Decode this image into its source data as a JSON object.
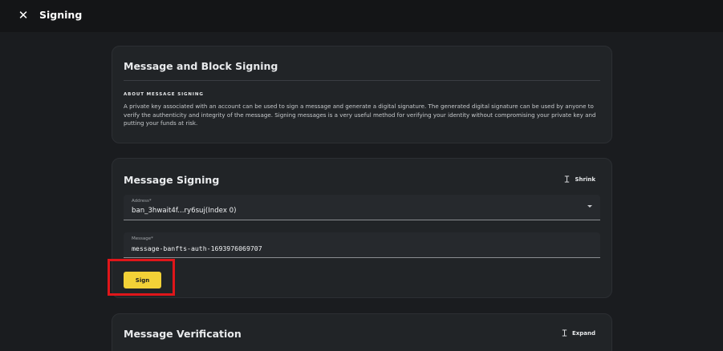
{
  "header": {
    "title": "Signing",
    "close_icon": "close-icon"
  },
  "about_card": {
    "title": "Message and Block Signing",
    "section_label": "ABOUT MESSAGE SIGNING",
    "description": "A private key associated with an account can be used to sign a message and generate a digital signature. The generated digital signature can be used by anyone to verify the authenticity and integrity of the message. Signing messages is a very useful method for verifying your identity without compromising your private key and putting your funds at risk."
  },
  "signing_card": {
    "title": "Message Signing",
    "shrink_label": "Shrink",
    "address": {
      "label": "Address*",
      "value": "ban_3hwait4f...ry6suj(Index 0)"
    },
    "message": {
      "label": "Message*",
      "value": "message-banfts-auth-1693976069707"
    },
    "sign_label": "Sign"
  },
  "verification_card": {
    "title": "Message Verification",
    "expand_label": "Expand"
  },
  "colors": {
    "background": "#1a1c1f",
    "card": "#212427",
    "accent": "#f2d137",
    "highlight": "#e0161a"
  }
}
